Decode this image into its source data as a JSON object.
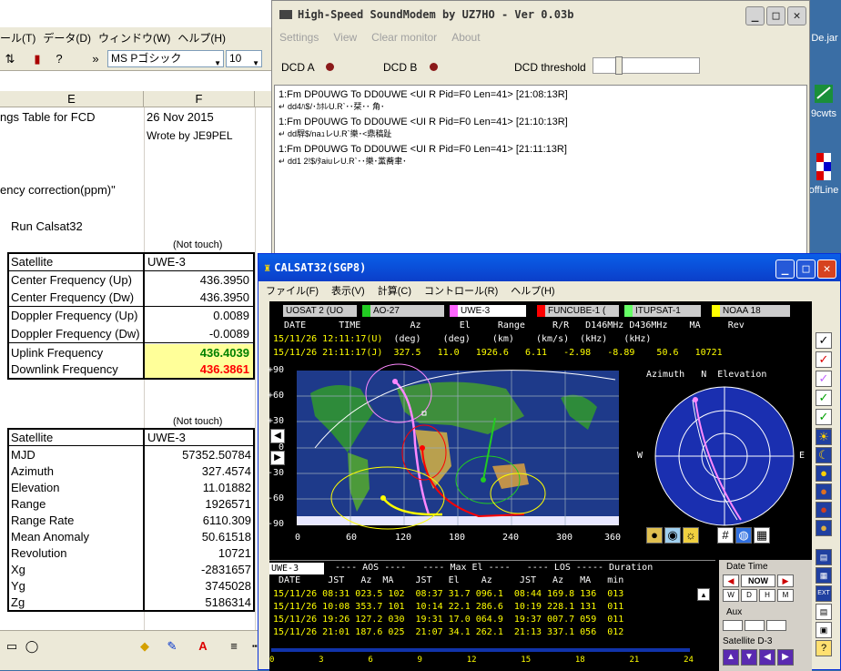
{
  "excel": {
    "menu": [
      "ール(T)",
      "データ(D)",
      "ウィンドウ(W)",
      "ヘルプ(H)"
    ],
    "font_name": "MS Pゴシック",
    "font_size": "10",
    "columns": [
      "E",
      "F"
    ],
    "title_cell": "ngs Table for FCD",
    "date_cell": "26 Nov 2015",
    "author_cell": "Wrote by JE9PEL",
    "note_cell": "ency correction(ppm)\"",
    "run_cell": "Run Calsat32",
    "not_touch_1": "(Not touch)",
    "table1": [
      {
        "label": "Satellite",
        "value": "UWE-3"
      },
      {
        "label": "Center Frequency (Up)",
        "value": "436.3950"
      },
      {
        "label": "Center Frequency (Dw)",
        "value": "436.3950"
      },
      {
        "label": "Doppler Frequency (Up)",
        "value": "0.0089"
      },
      {
        "label": "Doppler Frequency (Dw)",
        "value": "-0.0089"
      },
      {
        "label": "Uplink Frequency",
        "value": "436.4039"
      },
      {
        "label": "Downlink Frequency",
        "value": "436.3861"
      }
    ],
    "not_touch_2": "(Not touch)",
    "table2": [
      {
        "label": "Satellite",
        "value": "UWE-3"
      },
      {
        "label": "MJD",
        "value": "57352.50784"
      },
      {
        "label": "Azimuth",
        "value": "327.4574"
      },
      {
        "label": "Elevation",
        "value": "11.01882"
      },
      {
        "label": "Range",
        "value": "1926571"
      },
      {
        "label": "Range Rate",
        "value": "6110.309"
      },
      {
        "label": "Mean Anomaly",
        "value": "50.61518"
      },
      {
        "label": "Revolution",
        "value": "10721"
      },
      {
        "label": "Xg",
        "value": "-2831657"
      },
      {
        "label": "Yg",
        "value": "3745028"
      },
      {
        "label": "Zg",
        "value": "5186314"
      }
    ]
  },
  "desktop": {
    "icons": [
      "De.jar",
      "9cwts",
      "offLine"
    ]
  },
  "soundmodem": {
    "title": "High-Speed SoundModem by UZ7HO - Ver 0.03b",
    "menu": [
      "Settings",
      "View",
      "Clear monitor",
      "About"
    ],
    "dcd_a": "DCD A",
    "dcd_b": "DCD B",
    "dcd_threshold": "DCD threshold",
    "monitor": [
      "1:Fm DP0UWG To DD0UWE <UI R Pid=F0 Len=41> [21:08:13R]",
      "↵ dd4ﾊ$/･ｶﾎﾚU.R`･･栞･･ 角･",
      "1:Fm DP0UWG To DD0UWE <UI R Pid=F0 Len=41> [21:10:13R]",
      "↵ dd駻$/naｭレU.R`樂･<鼎稿趾",
      "1:Fm DP0UWG To DD0UWE <UI R Pid=F0 Len=41> [21:11:13R]",
      "↵ dd1 2!$/ﾀaiuレU.R`･･樂･黨蕎聿･"
    ]
  },
  "calsat": {
    "title": "CALSAT32(SGP8)",
    "menu": [
      "ファイル(F)",
      "表示(V)",
      "計算(C)",
      "コントロール(R)",
      "ヘルプ(H)"
    ],
    "sat_tabs": [
      {
        "name": "UOSAT 2 (UO",
        "color": "#000000"
      },
      {
        "name": "AO-27",
        "color": "#22cc22"
      },
      {
        "name": "UWE-3",
        "color": "#ff66ff"
      },
      {
        "name": "FUNCUBE-1 (",
        "color": "#ff0000"
      },
      {
        "name": "ITUPSAT-1",
        "color": "#66ff66"
      },
      {
        "name": "NOAA 18",
        "color": "#ffff00"
      }
    ],
    "header1": "  DATE      TIME         Az       El     Range     R/R   D146MHz D436MHz    MA     Rev",
    "header2": "                      (deg)    (deg)    (km)    (km/s)  (kHz)   (kHz)",
    "row_u": "15/11/26 12:11:17(U)",
    "row_j": "15/11/26 21:11:17(J)  327.5   11.0   1926.6   6.11   -2.98   -8.89    50.6   10721",
    "map_lat_labels": [
      "+90",
      "+60",
      "+30",
      "0",
      "-30",
      "-60",
      "-90"
    ],
    "map_lon_labels": [
      "0",
      "60",
      "120",
      "180",
      "240",
      "300",
      "360"
    ],
    "polar_title": "Azimuth   N  Elevation",
    "polar_w": "W",
    "polar_e": "E",
    "polar_s": "S",
    "pass_sat": "UWE-3",
    "pass_header1": " ---- AOS ----   ---- Max El ----   ---- LOS ----- Duration",
    "pass_header2": " DATE     JST   Az  MA    JST   El    Az     JST   Az   MA   min",
    "passes": [
      "15/11/26 08:31 023.5 102  08:37 31.7 096.1  08:44 169.8 136  013",
      "15/11/26 10:08 353.7 101  10:14 22.1 286.6  10:19 228.1 131  011",
      "15/11/26 19:26 127.2 030  19:31 17.0 064.9  19:37 007.7 059  011",
      "15/11/26 21:01 187.6 025  21:07 34.1 262.1  21:13 337.1 056  012"
    ],
    "hour_labels": [
      "0",
      "3",
      "6",
      "9",
      "12",
      "15",
      "18",
      "21",
      "24"
    ],
    "date_time_label": "Date Time",
    "now_label": "NOW",
    "aux_label": "Aux",
    "satellite_label": "Satellite  D-3"
  }
}
